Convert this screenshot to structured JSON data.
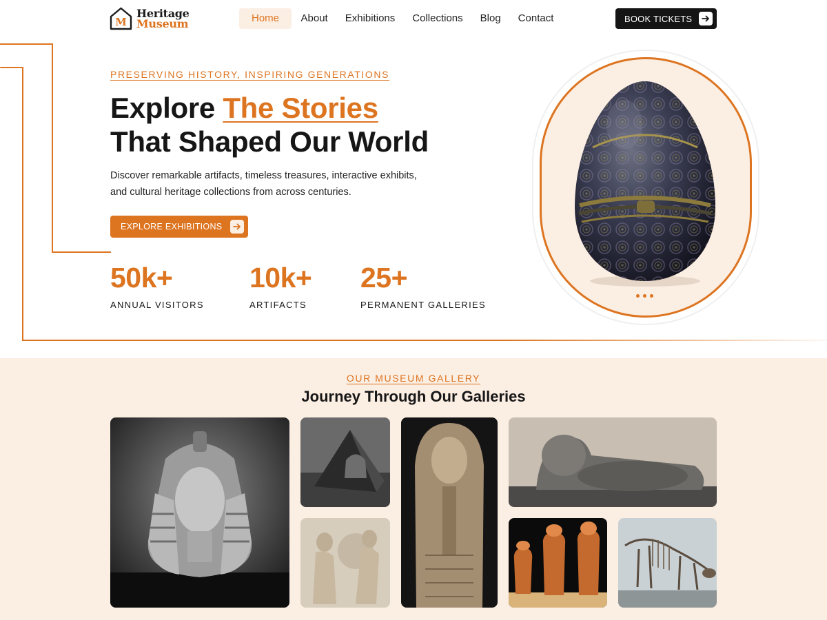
{
  "brand": {
    "line1": "Heritage",
    "line2": "Museum",
    "mark_letter": "M"
  },
  "nav": {
    "items": [
      {
        "label": "Home"
      },
      {
        "label": "About"
      },
      {
        "label": "Exhibitions"
      },
      {
        "label": "Collections"
      },
      {
        "label": "Blog"
      },
      {
        "label": "Contact"
      }
    ],
    "active": "Home",
    "cta_label": "BOOK TICKETS",
    "cta_icon": "arrow-right-icon"
  },
  "hero": {
    "eyebrow": "PRESERVING HISTORY, INSPIRING GENERATIONS",
    "title_part1": "Explore ",
    "title_accent": "The Stories",
    "title_line2": "That Shaped Our World",
    "description": "Discover remarkable artifacts, timeless treasures, interactive exhibits, and cultural heritage collections from across centuries.",
    "button_label": "EXPLORE EXHIBITIONS",
    "button_icon": "arrow-right-icon",
    "stats": [
      {
        "value": "50k+",
        "label": "ANNUAL VISITORS"
      },
      {
        "value": "10k+",
        "label": "ARTIFACTS"
      },
      {
        "value": "25+",
        "label": "PERMANENT GALLERIES"
      }
    ],
    "image": "ornate-egg-artifact"
  },
  "gallery": {
    "eyebrow": "OUR MUSEUM GALLERY",
    "title": "Journey Through Our Galleries",
    "tiles": [
      "pharaoh-bust",
      "pyramid-sculpture",
      "marble-relief",
      "sarcophagus",
      "lion-statue",
      "canopic-jars",
      "dinosaur-skeleton"
    ]
  },
  "colors": {
    "accent": "#dd7420",
    "accent_soft": "#fbeee3",
    "dark": "#151515"
  }
}
